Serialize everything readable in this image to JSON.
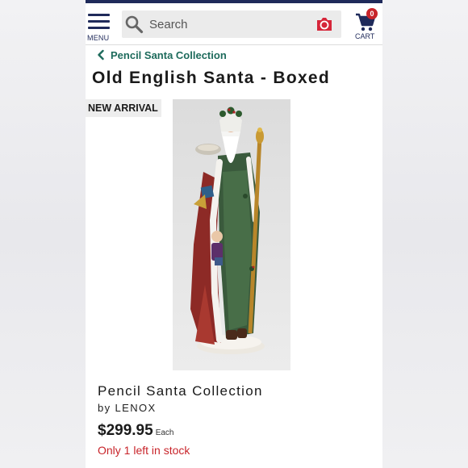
{
  "header": {
    "menu_label": "MENU",
    "search_placeholder": "Search",
    "cart_label": "CART",
    "cart_count": "0"
  },
  "breadcrumb": {
    "label": "Pencil Santa Collection"
  },
  "product": {
    "title": "Old English Santa - Boxed",
    "badge": "NEW ARRIVAL",
    "collection": "Pencil Santa Collection",
    "brand_line": "by LENOX",
    "price": "$299.95",
    "price_unit": "Each",
    "stock_status": "Only 1 left in stock"
  },
  "icons": {
    "menu": "hamburger-icon",
    "search": "search-icon",
    "camera": "camera-icon",
    "cart": "cart-icon",
    "back": "chevron-left-icon"
  },
  "colors": {
    "brand_navy": "#1f2a5a",
    "link_green": "#1e6b5c",
    "alert_red": "#c8242a",
    "search_bg": "#ebebeb"
  }
}
